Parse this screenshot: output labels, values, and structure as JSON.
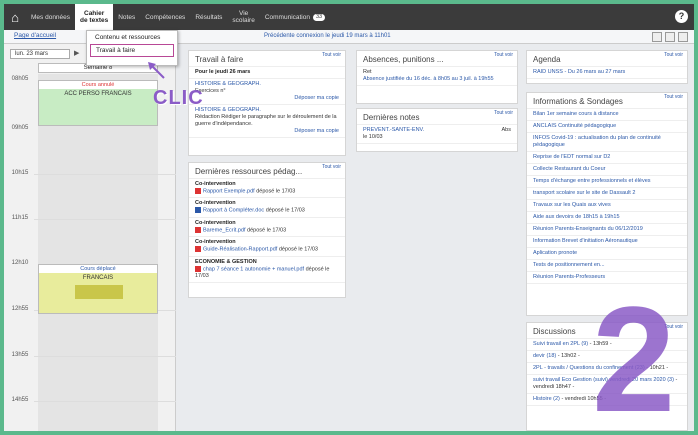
{
  "nav": {
    "items": [
      "Mes données",
      "Cahier\nde textes",
      "Notes",
      "Compétences",
      "Résultats",
      "Vie\nscolaire",
      "Communication"
    ],
    "communication_badge": "33",
    "help": "?"
  },
  "subbar": {
    "home_tab": "Page d'accueil",
    "connection": "Précédente connexion le jeudi 19 mars à 11h01"
  },
  "dropdown": {
    "item1": "Contenu et ressources",
    "item2": "Travail à faire"
  },
  "annotation": {
    "clic": "CLIC",
    "step": "2"
  },
  "agenda_left": {
    "date": "lun. 23 mars",
    "week": "Semaine 8",
    "hours": [
      "08h05",
      "09h05",
      "10h15",
      "11h15",
      "12h10",
      "12h55",
      "13h55",
      "14h55"
    ],
    "course1_status": "Cours annulé",
    "course1_name": "ACC PERSO FRANCAIS",
    "course2_status": "Cours déplacé",
    "course2_name": "FRANCAIS"
  },
  "travail": {
    "title": "Travail à faire",
    "tout_voir": "Tout voir",
    "date": "Pour le jeudi 26 mars",
    "item1_subject": "HISTOIRE & GEOGRAPH.",
    "item1_text": "Exercices n°",
    "depose": "Déposer ma copie",
    "item2_subject": "HISTOIRE & GEOGRAPH.",
    "item2_text": "Rédaction Rédiger le paragraphe sur le déroulement de la guerre d'indépendance."
  },
  "ressources": {
    "title": "Dernières ressources pédag...",
    "tout_voir": "Tout voir",
    "items": [
      {
        "subject": "Co-intervention",
        "file": "Rapport Exemple.pdf",
        "date": "déposé le 17/03"
      },
      {
        "subject": "Co-intervention",
        "file": "Rapport à Compléter.doc",
        "date": "déposé le 17/03"
      },
      {
        "subject": "Co-intervention",
        "file": "Bareme_Ecrit.pdf",
        "date": "déposé le 17/03"
      },
      {
        "subject": "Co-intervention",
        "file": "Guide-Réalisation-Rapport.pdf",
        "date": "déposé le 17/03"
      },
      {
        "subject": "ECONOMIE & GESTION",
        "file": "chap 7 séance 1 autonomie + manuel.pdf",
        "date": "déposé le 17/03"
      }
    ]
  },
  "absences": {
    "title": "Absences, punitions ...",
    "tout_voir": "Tout voir",
    "label": "Ret",
    "text": "Absence justifiée du 16 déc. à 8h05 au 3 juil. à 19h55"
  },
  "notes": {
    "title": "Dernières notes",
    "tout_voir": "Tout voir",
    "subject": "PREVENT.-SANTE-ENV.",
    "date": "le 10/03",
    "value": "Abs"
  },
  "agenda": {
    "title": "Agenda",
    "tout_voir": "Tout voir",
    "event": "RAID UNSS - Du 26 mars au 27 mars"
  },
  "infos": {
    "title": "Informations & Sondages",
    "tout_voir": "Tout voir",
    "items": [
      "Bilan 1er semaine cours à distance",
      "ANCLAIS Continuité pédagogique",
      "INFOS Covid-19 : actualisation du plan de continuité pédagogique",
      "Reprise de l'EDT normal sur D2",
      "Collecte Restaurant du Coeur",
      "Temps d'échange entre professionnels et élèves",
      "transport scolaire sur le site de Dassault 2",
      "Travaux sur les Quais aux vives",
      "Aide aux devoirs de 18h15 à 19h15",
      "Réunion Parents-Enseignants du 06/12/2019",
      "Information Brevet d'initiation Aéronautique",
      "Aplication pronote",
      "Tests de positionnement en...",
      "Réunion Parents-Professeurs"
    ]
  },
  "discussions": {
    "title": "Discussions",
    "tout_voir": "Tout voir",
    "items": [
      {
        "text": "Suivi travail en 2PL (9)",
        "meta": "- 13h59 -"
      },
      {
        "text": "devir (18)",
        "meta": "- 13h02 -"
      },
      {
        "text": "2PL - travails / Questions du confinement (23)",
        "meta": "- 10h21 -"
      },
      {
        "text": "suivi travail Eco Gestion (suivi) vendredi 20 mars 2020 (3)",
        "meta": "- vendredi 18h47 -"
      },
      {
        "text": "Histoire (2)",
        "meta": "- vendredi 10h55 -"
      }
    ]
  }
}
